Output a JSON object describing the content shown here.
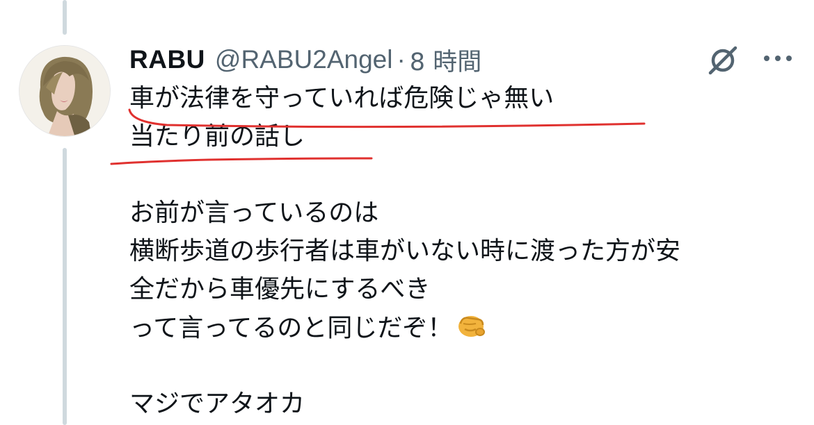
{
  "tweet": {
    "display_name": "RABU",
    "handle": "@RABU2Angel",
    "separator": "·",
    "time": "8 時間",
    "avatar_label": "avatar",
    "lines": [
      "車が法律を守っていれば危険じゃ無い",
      "当たり前の話し",
      "",
      "お前が言っているのは",
      "横断歩道の歩行者は車がいない時に渡った方が安",
      "全だから車優先にするべき",
      "って言ってるのと同じだぞ！",
      "",
      "マジでアタオカ"
    ],
    "emoji": "pointing-fist-emoji"
  },
  "icons": {
    "grok": "grok-icon",
    "more": "more-dots-icon"
  },
  "colors": {
    "text": "#0f1419",
    "secondary": "#536471",
    "thread_line": "#cfd9de",
    "annotation_red": "#e0312f"
  }
}
